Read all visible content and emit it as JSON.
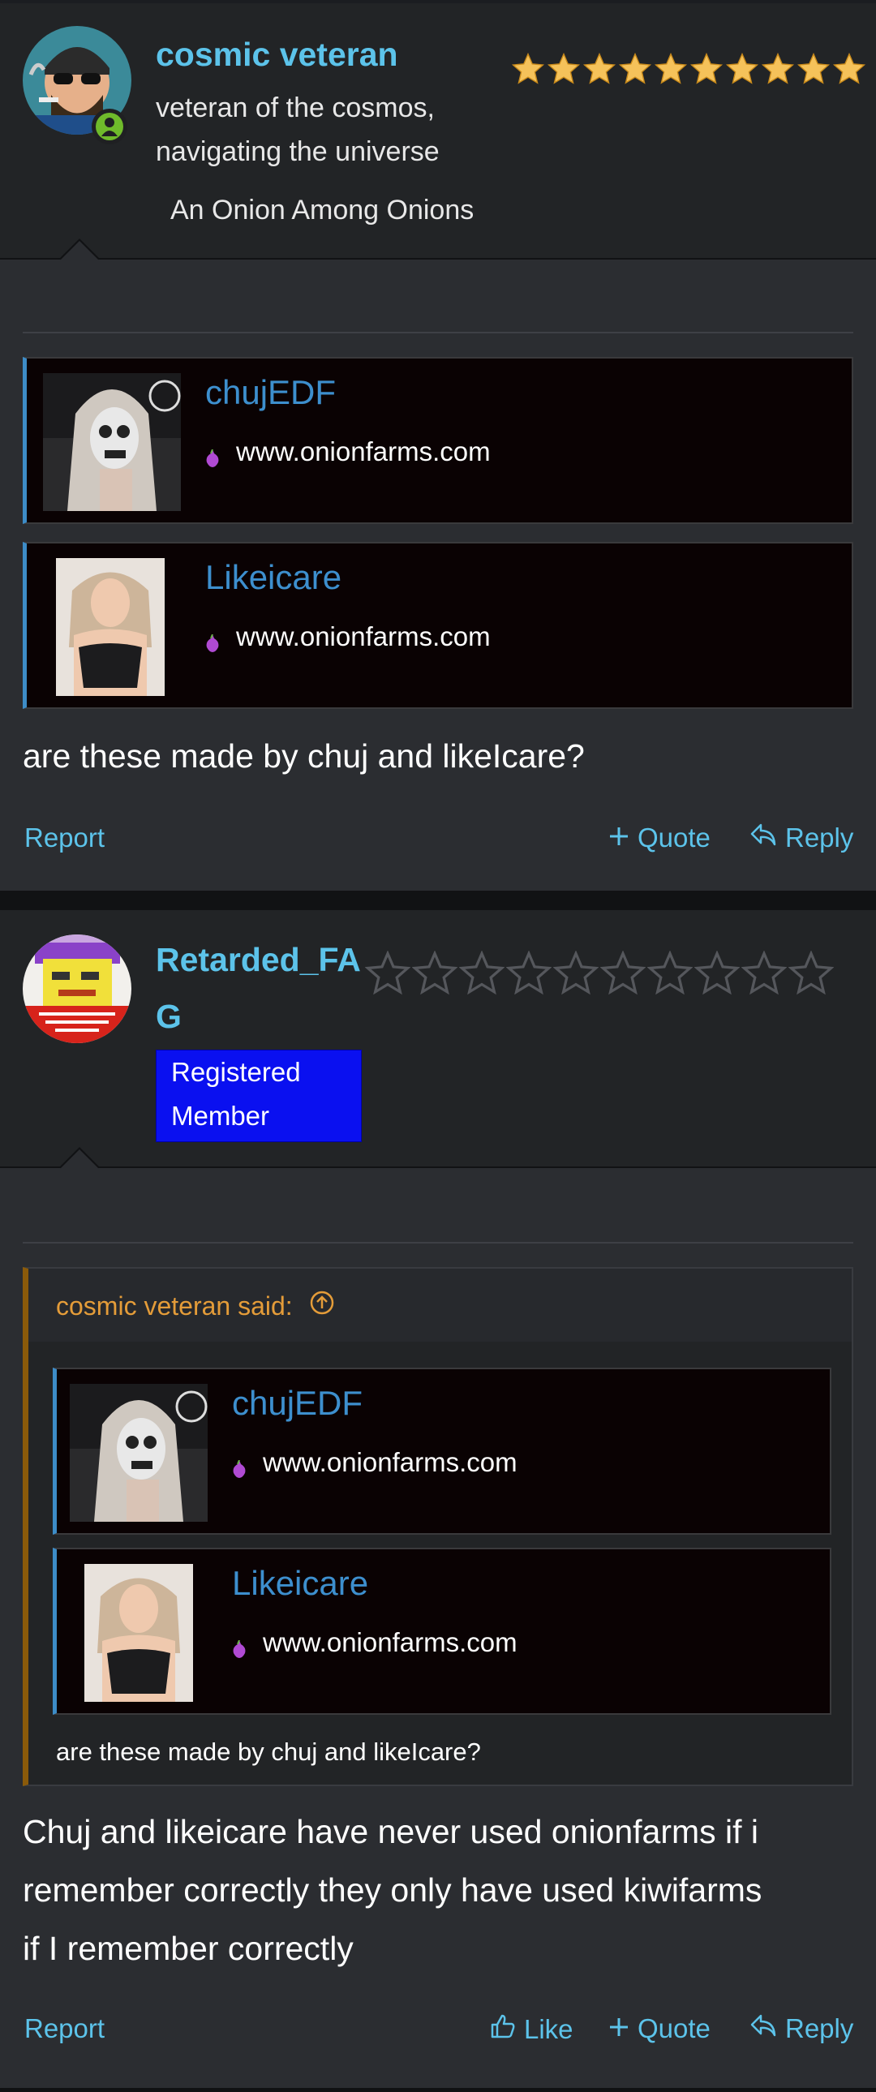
{
  "post1": {
    "username": "cosmic veteran",
    "user_title_line1": "veteran of the cosmos,",
    "user_title_line2": "navigating the universe",
    "banner": "An Onion Among Onions",
    "rating_filled": 10,
    "rating_total": 10,
    "embeds": [
      {
        "name": "chujEDF",
        "site": "www.onionfarms.com"
      },
      {
        "name": "Likeicare",
        "site": "www.onionfarms.com"
      }
    ],
    "body": "are these made by chuj and likeIcare?",
    "actions": {
      "report": "Report",
      "quote": "Quote",
      "reply": "Reply"
    }
  },
  "post2": {
    "username_line1": "Retarded_FA",
    "username_line2": "G",
    "badge_line1": "Registered",
    "badge_line2": "Member",
    "rating_filled": 0,
    "rating_total": 10,
    "quote": {
      "attribution": "cosmic veteran said:",
      "embeds": [
        {
          "name": "chujEDF",
          "site": "www.onionfarms.com"
        },
        {
          "name": "Likeicare",
          "site": "www.onionfarms.com"
        }
      ],
      "text": "are these made by chuj and likeIcare?"
    },
    "body_line1": "Chuj and likeicare have never used onionfarms if i",
    "body_line2": "remember correctly they only have used kiwifarms",
    "body_line3": "if I remember correctly",
    "actions": {
      "report": "Report",
      "like": "Like",
      "quote": "Quote",
      "reply": "Reply"
    }
  },
  "colors": {
    "accent": "#5cc3ea",
    "embed_name": "#3d8fce",
    "quote_attr": "#e49c39",
    "star": "#f5c25a",
    "badge": "#0a10f0",
    "online": "#6fbb2b"
  }
}
